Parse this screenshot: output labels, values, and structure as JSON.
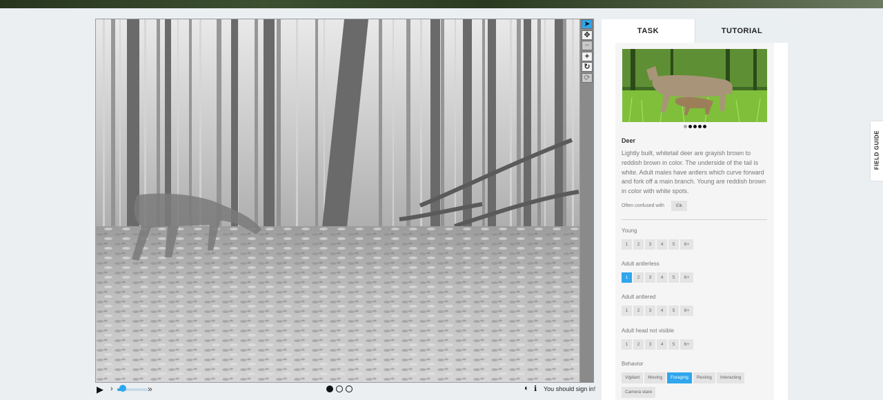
{
  "viewer": {
    "tools": [
      {
        "name": "pointer",
        "icon": "pointer-icon",
        "glyph": "➤",
        "state": "active"
      },
      {
        "name": "pan",
        "icon": "move-icon",
        "glyph": "✥",
        "state": "normal"
      },
      {
        "name": "zoom-out",
        "icon": "minus-icon",
        "glyph": "−",
        "state": "disabled"
      },
      {
        "name": "zoom-in",
        "icon": "plus-icon",
        "glyph": "+",
        "state": "normal"
      },
      {
        "name": "rotate",
        "icon": "rotate-icon",
        "glyph": "↻",
        "state": "normal"
      },
      {
        "name": "reset",
        "icon": "reset-icon",
        "glyph": "⟳",
        "state": "disabled"
      }
    ],
    "controls": {
      "play_glyph": "▶",
      "step_glyph": "›",
      "fast_glyph": "»",
      "frames": 3,
      "current_frame": 1,
      "contrast_glyph": "◐",
      "info_glyph": "ℹ",
      "signin_message": "You should sign in!"
    }
  },
  "tabs": {
    "task": "TASK",
    "tutorial": "TUTORIAL"
  },
  "species": {
    "name": "Deer",
    "description": "Lightly built, whitetail deer are grayish brown to reddish brown in color. The underside of the tail is white. Adult males have antlers which curve forward and fork off a main branch. Young are reddish brown in color with white spots.",
    "confused_label": "Often confused with",
    "confused_with": "Elk",
    "photo_dots": 5,
    "photo_current": 0
  },
  "questions": [
    {
      "label": "Young",
      "options": [
        "1",
        "2",
        "3",
        "4",
        "5",
        "6+"
      ],
      "selected": null
    },
    {
      "label": "Adult antlerless",
      "options": [
        "1",
        "2",
        "3",
        "4",
        "5",
        "6+"
      ],
      "selected": "1"
    },
    {
      "label": "Adult antlered",
      "options": [
        "1",
        "2",
        "3",
        "4",
        "5",
        "6+"
      ],
      "selected": null
    },
    {
      "label": "Adult head not visible",
      "options": [
        "1",
        "2",
        "3",
        "4",
        "5",
        "6+"
      ],
      "selected": null
    }
  ],
  "behavior": {
    "label": "Behavior",
    "options": [
      "Vigilant",
      "Moving",
      "Foraging",
      "Resting",
      "Interacting",
      "Camera stare"
    ],
    "selected": [
      "Foraging"
    ]
  },
  "field_guide_label": "FIELD GUIDE",
  "colors": {
    "accent": "#2fa6ee",
    "background": "#ebeff2"
  }
}
